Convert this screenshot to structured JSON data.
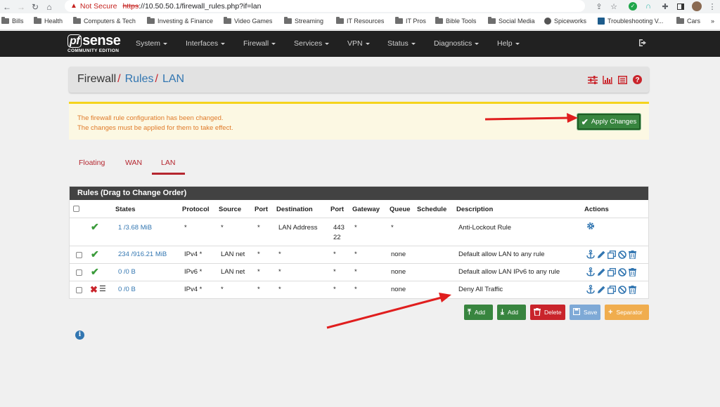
{
  "browser": {
    "security_label": "Not Secure",
    "url_scheme": "https",
    "url_rest": "://10.50.50.1/firewall_rules.php?if=lan",
    "bookmarks": [
      "Bills",
      "Health",
      "Computers & Tech",
      "Investing & Finance",
      "Video Games",
      "Streaming",
      "IT Resources",
      "IT Pros",
      "Bible Tools",
      "Social Media",
      "Spiceworks",
      "Troubleshooting V...",
      "Cars"
    ],
    "more_label": "»"
  },
  "navbar": {
    "logo_pf": "pf",
    "logo_main": "sense",
    "logo_sub": "COMMUNITY EDITION",
    "menus": [
      "System",
      "Interfaces",
      "Firewall",
      "Services",
      "VPN",
      "Status",
      "Diagnostics",
      "Help"
    ]
  },
  "breadcrumb": {
    "part1": "Firewall",
    "part2": "Rules",
    "part3": "LAN",
    "separator": "/"
  },
  "alert": {
    "line1": "The firewall rule configuration has been changed.",
    "line2": "The changes must be applied for them to take effect.",
    "apply_label": "Apply Changes"
  },
  "tabs": [
    "Floating",
    "WAN",
    "LAN"
  ],
  "rules": {
    "title": "Rules (Drag to Change Order)",
    "headers": {
      "states": "States",
      "protocol": "Protocol",
      "source": "Source",
      "port": "Port",
      "destination": "Destination",
      "dport": "Port",
      "gateway": "Gateway",
      "queue": "Queue",
      "schedule": "Schedule",
      "description": "Description",
      "actions": "Actions"
    },
    "rows": [
      {
        "states": "1 /3.68 MiB",
        "protocol": "*",
        "source": "*",
        "port": "*",
        "destination": "LAN Address",
        "dport1": "443",
        "dport2": "22",
        "gateway": "*",
        "queue": "*",
        "schedule": "",
        "description": "Anti-Lockout Rule"
      },
      {
        "states": "234 /916.21 MiB",
        "protocol": "IPv4 *",
        "source": "LAN net",
        "port": "*",
        "destination": "*",
        "dport1": "*",
        "dport2": "",
        "gateway": "*",
        "queue": "none",
        "schedule": "",
        "description": "Default allow LAN to any rule"
      },
      {
        "states": "0 /0 B",
        "protocol": "IPv6 *",
        "source": "LAN net",
        "port": "*",
        "destination": "*",
        "dport1": "*",
        "dport2": "",
        "gateway": "*",
        "queue": "none",
        "schedule": "",
        "description": "Default allow LAN IPv6 to any rule"
      },
      {
        "states": "0 /0 B",
        "protocol": "IPv4 *",
        "source": "*",
        "port": "*",
        "destination": "*",
        "dport1": "*",
        "dport2": "",
        "gateway": "*",
        "queue": "none",
        "schedule": "",
        "description": "Deny All Traffic"
      }
    ]
  },
  "buttons": {
    "add_top": "Add",
    "add_bottom": "Add",
    "delete": "Delete",
    "save": "Save",
    "separator": "Separator"
  },
  "colors": {
    "navbar": "#212121",
    "accent_red": "#b5262f",
    "link_blue": "#3276b1",
    "success_green": "#38853f",
    "alert_bg": "#fcf8e3",
    "alert_border": "#f5d41d",
    "delete_red": "#c9242b",
    "save_blue": "#7ea9d6",
    "separator_orange": "#f0ad4e"
  }
}
